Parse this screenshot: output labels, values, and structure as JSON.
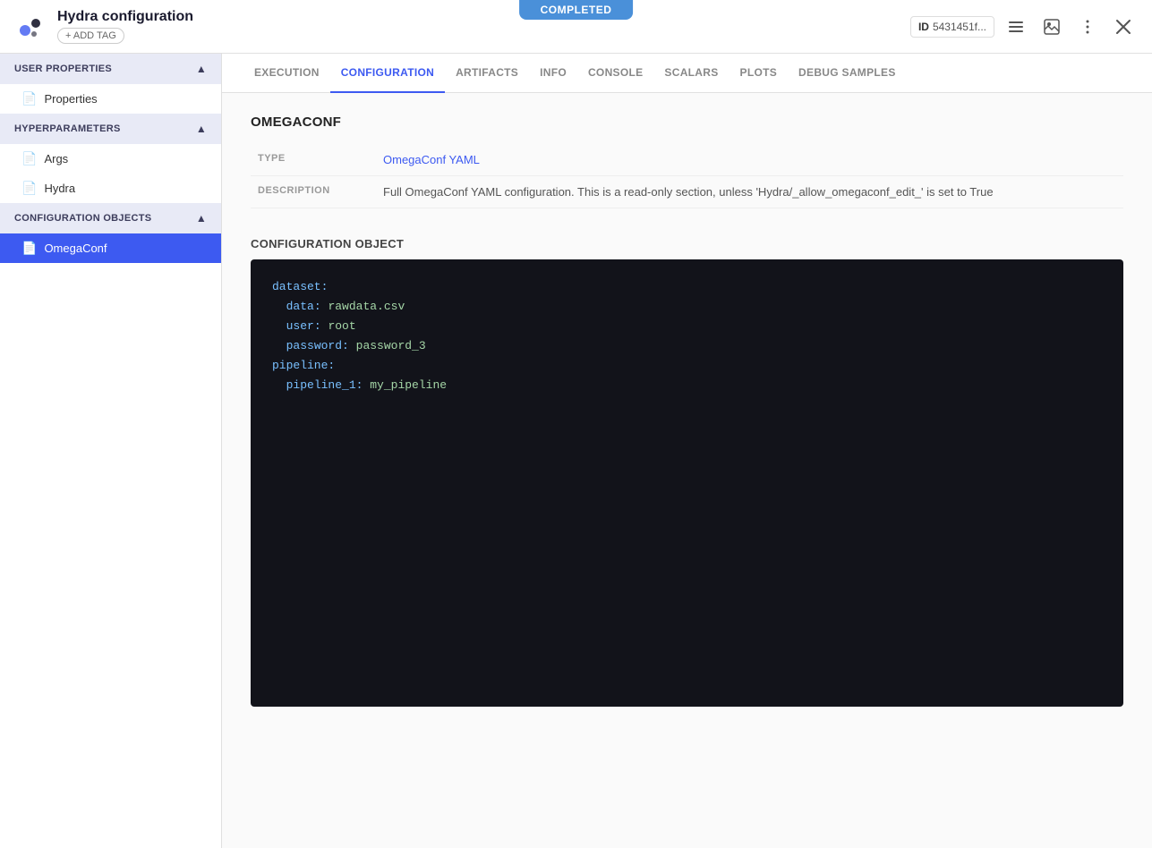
{
  "completed_banner": "COMPLETED",
  "header": {
    "title": "Hydra configuration",
    "add_tag_label": "+ ADD TAG",
    "id_label": "ID",
    "id_value": "5431451f...",
    "icons": {
      "list": "☰",
      "image": "🖼",
      "menu": "⋮",
      "close": "✕"
    }
  },
  "sidebar": {
    "sections": [
      {
        "id": "user-properties",
        "label": "USER PROPERTIES",
        "items": [
          {
            "id": "properties",
            "label": "Properties"
          }
        ]
      },
      {
        "id": "hyperparameters",
        "label": "HYPERPARAMETERS",
        "items": [
          {
            "id": "args",
            "label": "Args"
          },
          {
            "id": "hydra",
            "label": "Hydra"
          }
        ]
      },
      {
        "id": "configuration-objects",
        "label": "CONFIGURATION OBJECTS",
        "items": [
          {
            "id": "omegaconf",
            "label": "OmegaConf",
            "active": true
          }
        ]
      }
    ]
  },
  "tabs": [
    {
      "id": "execution",
      "label": "EXECUTION"
    },
    {
      "id": "configuration",
      "label": "CONFIGURATION",
      "active": true
    },
    {
      "id": "artifacts",
      "label": "ARTIFACTS"
    },
    {
      "id": "info",
      "label": "INFO"
    },
    {
      "id": "console",
      "label": "CONSOLE"
    },
    {
      "id": "scalars",
      "label": "SCALARS"
    },
    {
      "id": "plots",
      "label": "PLOTS"
    },
    {
      "id": "debug-samples",
      "label": "DEBUG SAMPLES"
    }
  ],
  "omegaconf_section": {
    "title": "OMEGACONF",
    "type_label": "TYPE",
    "type_value": "OmegaConf YAML",
    "desc_label": "DESCRIPTION",
    "desc_value": "Full OmegaConf YAML configuration. This is a read-only section, unless 'Hydra/_allow_omegaconf_edit_' is set to True",
    "config_obj_label": "CONFIGURATION OBJECT",
    "code_lines": [
      "dataset:",
      "  data: rawdata.csv",
      "  user: root",
      "  password: password_3",
      "pipeline:",
      "  pipeline_1: my_pipeline"
    ]
  }
}
